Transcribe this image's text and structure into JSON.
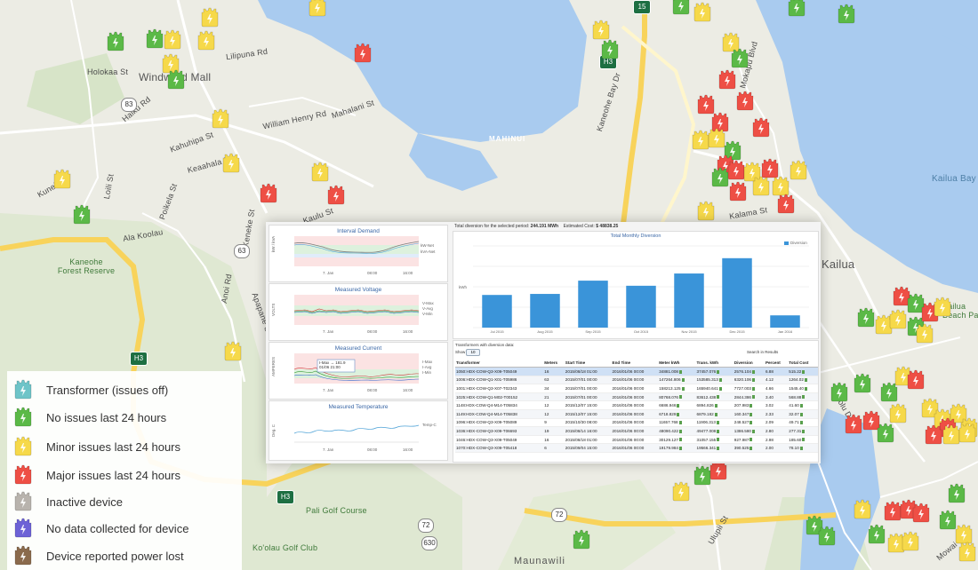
{
  "map": {
    "labels": {
      "lilipuna": "Lilipuna Rd",
      "holokaa": "Holokaa St",
      "haiku": "Haiku Rd",
      "windward": "Windward Mall",
      "william_henry": "William Henry Rd",
      "mahalani": "Mahalani St",
      "kahuhipa": "Kahuhipa St",
      "keaahala": "Keaahala Rd",
      "kuneki": "Kuneki St",
      "loiliu": "Loili St",
      "poikela": "Poikela St",
      "kaneohe_forest": "Kaneohe\nForest Reserve",
      "ala_koolau": "Ala Koolau",
      "kamehameha_hwy": "Kamehameha Hwy",
      "kaneohe_bay": "Kaneohe Bay Dr",
      "mahinui": "MAHINUI",
      "mokapu": "Mokapu Blvd",
      "kalama": "Kalama St",
      "kailua_bay": "Kailua Bay",
      "kailua": "Kailua",
      "kailua_beach_park": "Kailua\nBeach Park",
      "pali_golf": "Pali Golf Course",
      "koolau_golf": "Ko'olau Golf Club",
      "maunawili": "Maunawili",
      "ulupii": "Ulupii St",
      "mowai": "Mowai St",
      "keolu": "Keolu Dr",
      "apapane": "Apapane St",
      "keneke": "Keneke St",
      "anoi": "Anoi Rd",
      "kaulu": "Kaulu St",
      "pali": "Pali Hwy",
      "freeway": "Kaneohe Bay Dr / H3 Burns Fwy"
    },
    "shields": {
      "r83": "83",
      "r63": "63",
      "r630": "630",
      "h3a": "H3",
      "h3b": "H3",
      "h3c": "H3",
      "r72a": "72",
      "r72b": "72",
      "r61": "61",
      "r15": "15"
    }
  },
  "legend": {
    "items": [
      {
        "label": "Transformer (issues off)",
        "color": "#6ec4c8"
      },
      {
        "label": "No issues last 24 hours",
        "color": "#5bb947"
      },
      {
        "label": "Minor issues last 24 hours",
        "color": "#f6d94a"
      },
      {
        "label": "Major issues last 24 hours",
        "color": "#ee4f45"
      },
      {
        "label": "Inactive device",
        "color": "#b8b3ad"
      },
      {
        "label": "No data collected for device",
        "color": "#6d62d6"
      },
      {
        "label": "Device reported power lost",
        "color": "#8a6a4c"
      }
    ]
  },
  "dashboard": {
    "interval": {
      "title": "Interval Demand",
      "ylabel": "kW / kVA",
      "legend": [
        "kW-Net",
        "kVA-Net"
      ],
      "xticks": [
        "7. Jan",
        "08:00",
        "16:00"
      ]
    },
    "voltage": {
      "title": "Measured Voltage",
      "ylabel": "VOLTS",
      "legend": [
        "V-Max",
        "V-Avg",
        "V-Min"
      ],
      "xticks": [
        "7. Jan",
        "08:00",
        "16:00"
      ]
    },
    "current": {
      "title": "Measured Current",
      "ylabel": "AMPERES",
      "legend": [
        "I-Max",
        "I-Avg",
        "I-Min"
      ],
      "xticks": [
        "7. Jan",
        "08:00",
        "16:00"
      ],
      "tooltip": "I-Max → 181.9\n01/06 21:00"
    },
    "temperature": {
      "title": "Measured Temperature",
      "ylabel": "Deg. C",
      "legend": [
        "Temp-C"
      ],
      "xticks": [
        "7. Jan",
        "08:00",
        "16:00"
      ]
    },
    "summary": {
      "diversion_label": "Total diversion for the selected period:",
      "diversion_value": "244.191 MWh",
      "cost_label": "Estimated Cost:",
      "cost_value": "$ 48838.25"
    },
    "monthly": {
      "title": "Total Monthly Diversion",
      "legend": "Diversion",
      "ylabel": "kWh"
    },
    "table": {
      "caption": "Transformers with diversion data:",
      "show_label": "Show",
      "show_value": "10",
      "search_label": "Search in Results",
      "columns": [
        "Transformer",
        "Meters",
        "Start Time",
        "End Time",
        "Meter kWh",
        "Trans. kWh",
        "Diversion",
        "Percent",
        "Total Cost"
      ],
      "rows": [
        [
          "1050:HDX-COW-Q3-X09-T05049",
          "16",
          "2015/08/18 01:00",
          "2016/01/06 00:00",
          "34881.008",
          "37457.076",
          "2576.104",
          "6.88",
          "515.22"
        ],
        [
          "1006:HDX-COW-Q1-X01-T05986",
          "63",
          "2015/07/01 00:00",
          "2016/01/06 00:00",
          "147264.806",
          "153585.313",
          "6320.106",
          "4.12",
          "1264.02"
        ],
        [
          "1001:HDX-COW-Q3-X07-T02343",
          "34",
          "2015/07/01 00:00",
          "2016/01/06 00:00",
          "158213.125",
          "165940.641",
          "7727.003",
          "4.66",
          "1545.40"
        ],
        [
          "1025:HDX-COW-Q1-M02-T00152",
          "21",
          "2015/07/01 00:00",
          "2016/01/06 00:00",
          "80768.076",
          "83612.438",
          "2844.386",
          "3.40",
          "568.88"
        ],
        [
          "1148:HDX-COW-Q4-M14-T05834",
          "12",
          "2015/12/07 15:00",
          "2016/01/06 00:00",
          "6686.946",
          "6894.826",
          "207.983",
          "3.02",
          "41.60"
        ],
        [
          "1149:HDX-COW-Q4-M14-T05838",
          "12",
          "2015/12/07 15:00",
          "2016/01/06 00:00",
          "6718.829",
          "6879.182",
          "160.347",
          "2.33",
          "32.07"
        ],
        [
          "1096:HDX-COW-Q3-X09-T05089",
          "9",
          "2015/10/30 08:00",
          "2016/01/06 00:00",
          "11657.768",
          "11906.313",
          "248.527",
          "2.09",
          "49.71"
        ],
        [
          "1036:HDX-COW-Q3-X09-T06693",
          "19",
          "2015/08/14 16:00",
          "2016/01/06 00:00",
          "48090.422",
          "49477.008",
          "1386.580",
          "2.80",
          "277.31"
        ],
        [
          "1046:HDX-COW-Q3-X09-T05049",
          "16",
          "2015/08/18 01:00",
          "2016/01/06 00:00",
          "30129.127",
          "31057.155",
          "927.987",
          "2.98",
          "185.60"
        ],
        [
          "1070:HDX-COW-Q3-X09-T05418",
          "6",
          "2015/09/04 15:00",
          "2016/01/06 00:00",
          "19179.984",
          "19566.341",
          "390.525",
          "2.00",
          "78.10"
        ]
      ]
    }
  },
  "chart_data": {
    "type": "bar",
    "title": "Total Monthly Diversion",
    "categories": [
      "Jul 2015",
      "Aug 2015",
      "Sep 2015",
      "Oct 2015",
      "Nov 2015",
      "Dec 2015",
      "Jan 2016"
    ],
    "series": [
      {
        "name": "Diversion",
        "values": [
          32,
          33,
          46,
          41,
          53,
          68,
          12
        ]
      }
    ],
    "ylabel": "kWh",
    "ylim": [
      0,
      80
    ],
    "grid": true,
    "legend": "top-right"
  }
}
